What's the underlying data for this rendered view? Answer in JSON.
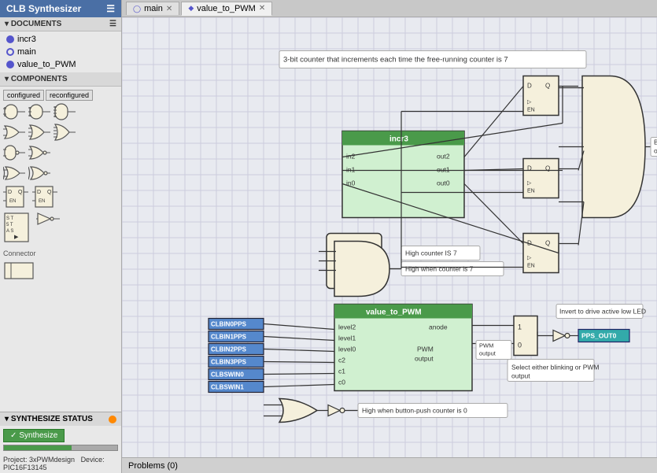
{
  "app": {
    "title": "CLB Synthesizer"
  },
  "sidebar": {
    "title": "CLB Synthesizer",
    "docs_header": "DOCUMENTS",
    "components_header": "COMPONENTS",
    "synth_header": "SYNTHESIZE STATUS",
    "documents": [
      {
        "name": "incr3",
        "type": "v"
      },
      {
        "name": "main",
        "type": "o"
      },
      {
        "name": "value_to_PWM",
        "type": "v"
      }
    ],
    "comp_buttons": [
      "configured",
      "reconfigured"
    ],
    "synth_button": "Synthesize",
    "progress": 60,
    "project": "Project: 3xPWMdesign",
    "device": "Device: PIC16F13145"
  },
  "tabs": [
    {
      "label": "main",
      "icon": "circle",
      "active": false,
      "closable": true
    },
    {
      "label": "value_to_PWM",
      "icon": "diamond",
      "active": true,
      "closable": true
    }
  ],
  "canvas": {
    "annotation": "3-bit counter that increments each time the free-running counter is 7",
    "incr3": {
      "title": "incr3",
      "ports_left": [
        "in2",
        "in1",
        "in0"
      ],
      "ports_right": [
        "out2",
        "out1",
        "out0"
      ]
    },
    "value_to_PWM": {
      "title": "value_to_PWM",
      "ports_left": [
        "level2",
        "level1",
        "level0",
        "c2",
        "c1",
        "c0"
      ],
      "ports_right": [
        "anode",
        "PWM output"
      ]
    },
    "blue_inputs": [
      "CLBIN0PPS",
      "CLBIN1PPS",
      "CLBIN2PPS",
      "CLBIN3PPS",
      "CLBSWIN0",
      "CLBSWIN1"
    ],
    "labels": [
      "High when counter is 7",
      "High counter IS 7",
      "Blinking output",
      "Select either blinking or PWM output",
      "Invert to drive active low LED",
      "High when button-push counter is 0"
    ],
    "output_label": "PPS_OUT0",
    "mux_labels": [
      "1",
      "0"
    ],
    "dff_labels": [
      "D",
      "Q",
      "EN"
    ]
  },
  "problems": "Problems (0)"
}
